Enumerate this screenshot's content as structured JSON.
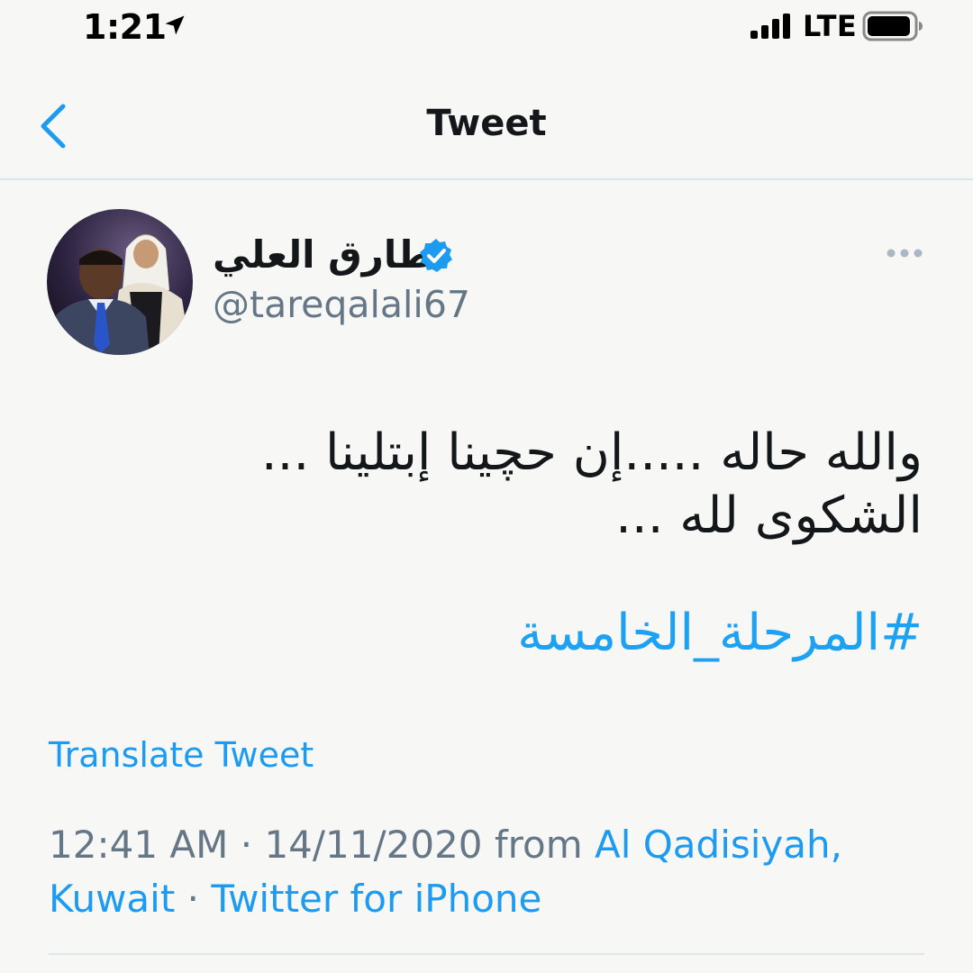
{
  "status_bar": {
    "time": "1:21",
    "network": "LTE"
  },
  "nav": {
    "title": "Tweet"
  },
  "tweet": {
    "author_name": "طارق العلي",
    "handle": "@tareqalali67",
    "text_lines": [
      "والله حاله .....إن حچينا إبتلينا ...",
      "الشكوى لله ..."
    ],
    "hashtag": "#المرحلة_الخامسة",
    "translate_label": "Translate Tweet",
    "time": "12:41 AM",
    "date": "14/11/2020",
    "from_label": "from",
    "location_part1": "Al Qadisiyah,",
    "location_part2": "Kuwait",
    "separator": "·",
    "source": "Twitter for iPhone"
  },
  "colors": {
    "accent": "#1d9bf0",
    "secondary_text": "#657786",
    "divider": "#d6e6f3"
  }
}
